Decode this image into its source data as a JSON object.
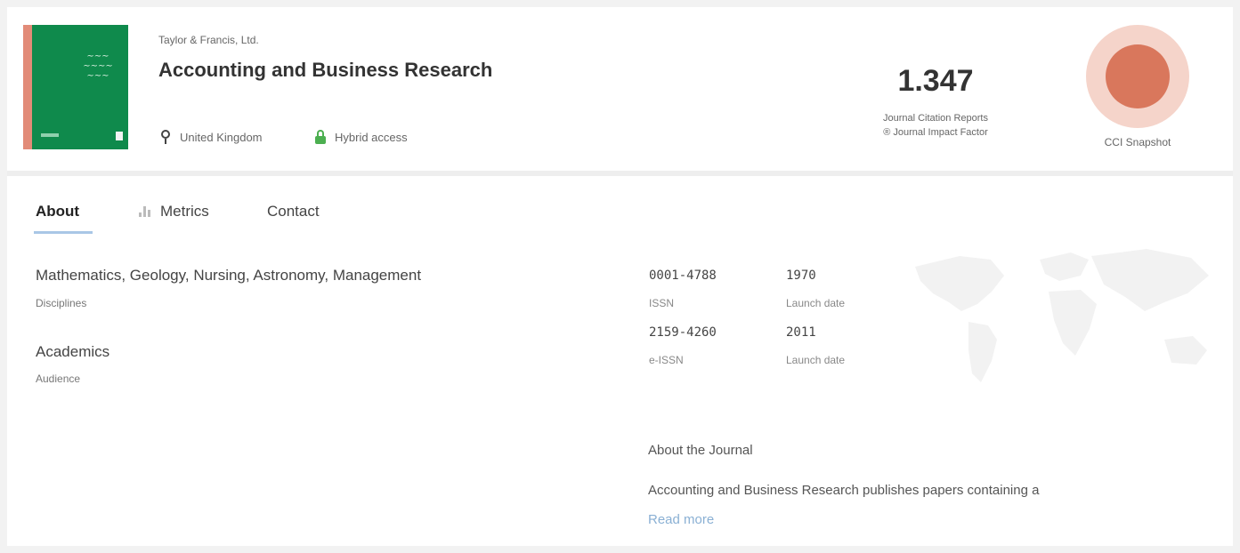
{
  "header": {
    "publisher": "Taylor & Francis, Ltd.",
    "journal_title": "Accounting and Business Research",
    "country": "United Kingdom",
    "access_type": "Hybrid access",
    "jif_value": "1.347",
    "jif_label_line1": "Journal Citation Reports",
    "jif_label_line2": "® Journal Impact Factor",
    "snapshot_label": "CCI Snapshot",
    "snapshot_color": "#d9775c"
  },
  "tabs": [
    {
      "label": "About",
      "active": true
    },
    {
      "label": "Metrics",
      "icon": "bar-chart-icon",
      "active": false
    },
    {
      "label": "Contact",
      "active": false
    }
  ],
  "about": {
    "disciplines_value": "Mathematics, Geology, Nursing, Astronomy, Management",
    "disciplines_label": "Disciplines",
    "audience_value": "Academics",
    "audience_label": "Audience",
    "identifiers": [
      {
        "value": "0001-4788",
        "label": "ISSN",
        "date": "1970",
        "date_label": "Launch date"
      },
      {
        "value": "2159-4260",
        "label": "e-ISSN",
        "date": "2011",
        "date_label": "Launch date"
      }
    ],
    "about_heading": "About the Journal",
    "about_excerpt": "Accounting and Business Research publishes papers containing a",
    "read_more": "Read more"
  }
}
